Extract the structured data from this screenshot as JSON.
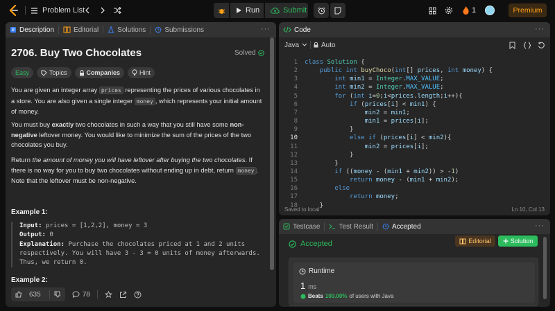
{
  "nav": {
    "problem_list_label": "Problem List",
    "run_label": "Run",
    "submit_label": "Submit",
    "streak_count": "1",
    "premium_label": "Premium"
  },
  "left_panel": {
    "tabs": [
      {
        "label": "Description"
      },
      {
        "label": "Editorial"
      },
      {
        "label": "Solutions"
      },
      {
        "label": "Submissions"
      }
    ],
    "problem_title": "2706. Buy Two Chocolates",
    "status": "Solved",
    "chips": {
      "difficulty": "Easy",
      "topics": "Topics",
      "companies": "Companies",
      "hint": "Hint"
    },
    "para1": {
      "t1": "You are given an integer array ",
      "c1": "prices",
      "t2": " representing the prices of various chocolates in a store. You are also given a single integer ",
      "c2": "money",
      "t3": ", which represents your initial amount of money."
    },
    "para2": {
      "t1": "You must buy ",
      "b1": "exactly",
      "t2": " two chocolates in such a way that you still have some ",
      "b2": "non-negative",
      "t3": " leftover money. You would like to minimize the sum of the prices of the two chocolates you buy."
    },
    "para3": {
      "t1": "Return ",
      "i1": "the amount of money you will have leftover after buying the two chocolates",
      "t2": ". If there is no way for you to buy two chocolates without ending up in debt, return ",
      "c1": "money",
      "t3": ". Note that the leftover must be non-negative."
    },
    "example1_heading": "Example 1:",
    "example1": {
      "input_label": "Input:",
      "input_value": " prices = [1,2,2], money = 3",
      "output_label": "Output:",
      "output_value": " 0",
      "explanation_label": "Explanation:",
      "explanation_value": " Purchase the chocolates priced at 1 and 2 units respectively. You will have 3 - 3 = 0 units of money afterwards. Thus, we return 0."
    },
    "example2_heading": "Example 2:",
    "likes": "635",
    "comments": "78"
  },
  "code_panel": {
    "tab_label": "Code",
    "language": "Java",
    "autosave_mode": "Auto",
    "lines": [
      "class Solution {",
      "    public int buyChoco(int[] prices, int money) {",
      "        int min1 = Integer.MAX_VALUE;",
      "        int min2 = Integer.MAX_VALUE;",
      "        for (int i=0;i<prices.length;i++){",
      "            if (prices[i] < min1) {",
      "                min2 = min1;",
      "                min1 = prices[i];",
      "            }",
      "            else if (prices[i] < min2){",
      "                min2 = prices[i];",
      "            }",
      "        }",
      "        if ((money - (min1 + min2)) > -1)",
      "            return money - (min1 + min2);",
      "        else",
      "            return money;",
      "    }"
    ],
    "saved_status": "Saved to local",
    "cursor_pos": "Ln 10, Col 13"
  },
  "result_panel": {
    "tabs": [
      {
        "label": "Testcase"
      },
      {
        "label": "Test Result"
      },
      {
        "label": "Accepted"
      }
    ],
    "verdict": "Accepted",
    "editorial_btn": "Editorial",
    "solution_btn": "Solution",
    "runtime_label": "Runtime",
    "runtime_value": "1",
    "runtime_unit": "ms",
    "beats_label": "Beats",
    "beats_value": "100.00%",
    "beats_suffix": "of users with Java"
  }
}
